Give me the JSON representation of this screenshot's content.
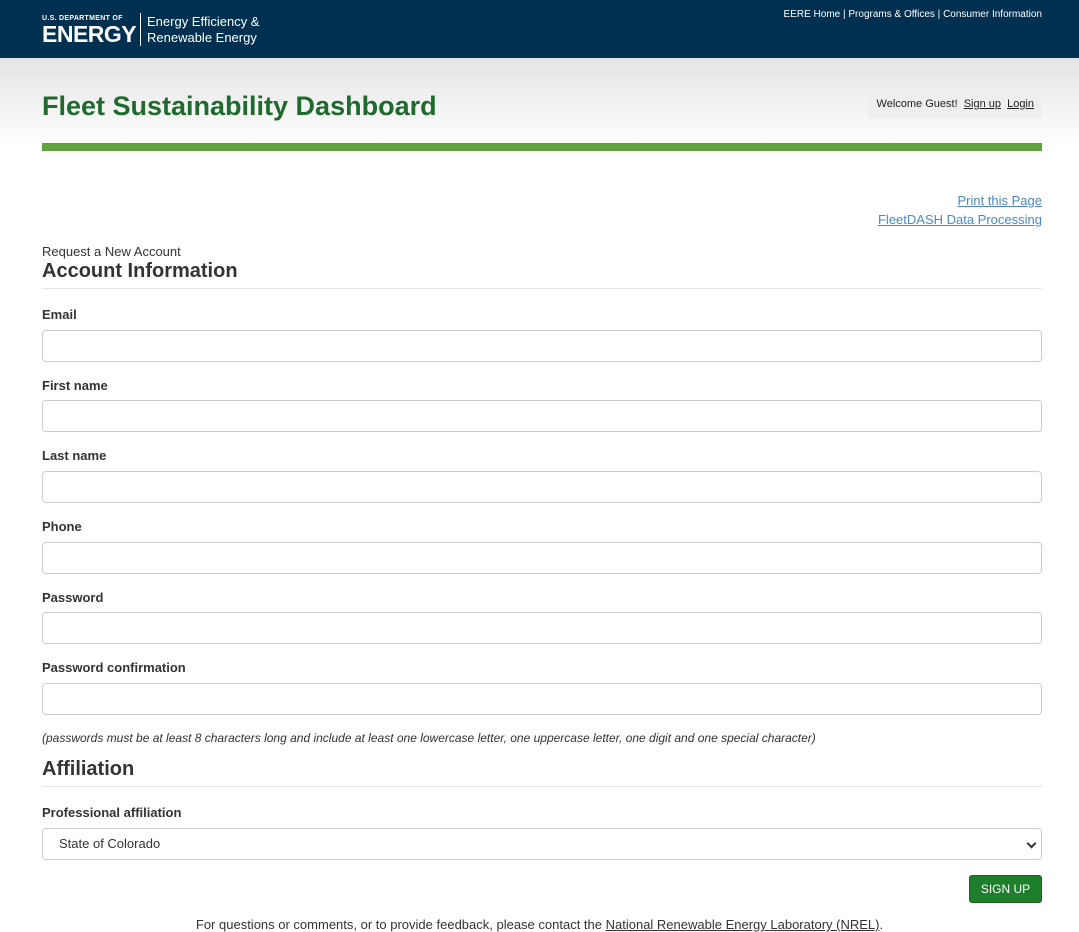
{
  "brand": {
    "doe_small": "U.S. DEPARTMENT OF",
    "doe_big": "ENERGY",
    "office_line1": "Energy Efficiency &",
    "office_line2": "Renewable Energy"
  },
  "top_nav": {
    "eere_home": "EERE Home",
    "separator": " | ",
    "programs": "Programs & Offices",
    "consumer": "Consumer Information"
  },
  "header": {
    "title": "Fleet Sustainability Dashboard",
    "welcome": "Welcome Guest!",
    "sign_up": "Sign up",
    "login": "Login"
  },
  "utility_links": {
    "print": "Print this Page",
    "data_processing": "FleetDASH Data Processing"
  },
  "form": {
    "request_label": "Request a New Account",
    "account_heading": "Account Information",
    "fields": {
      "email": {
        "label": "Email",
        "value": ""
      },
      "first_name": {
        "label": "First name",
        "value": ""
      },
      "last_name": {
        "label": "Last name",
        "value": ""
      },
      "phone": {
        "label": "Phone",
        "value": ""
      },
      "password": {
        "label": "Password",
        "value": ""
      },
      "password_confirmation": {
        "label": "Password confirmation",
        "value": ""
      }
    },
    "password_hint": "(passwords must be at least 8 characters long and include at least one lowercase letter, one uppercase letter, one digit and one special character)",
    "affiliation_heading": "Affiliation",
    "affiliation_label": "Professional affiliation",
    "affiliation_selected": "State of Colorado",
    "submit": "SIGN UP"
  },
  "footer": {
    "text": "For questions or comments, or to provide feedback, please contact the ",
    "link": "National Renewable Energy Laboratory (NREL)",
    "suffix": "."
  },
  "colors": {
    "topbar": "#00304f",
    "title_green": "#1e6b2d",
    "accent_bar": "#5ea43a",
    "link_blue": "#4a8ac4",
    "button_green": "#1d7e2b"
  }
}
